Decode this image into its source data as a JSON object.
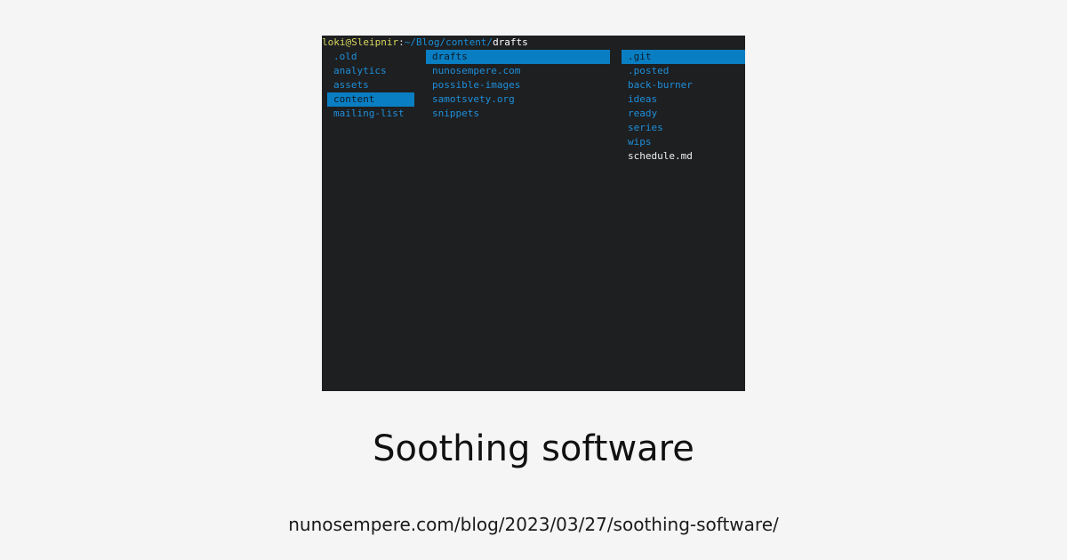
{
  "terminal": {
    "prompt": {
      "user": "loki@Sleipnir",
      "separator": ":",
      "path": "~/Blog/content/",
      "current": "drafts"
    },
    "parent_column": [
      {
        "name": ".old",
        "selected": false
      },
      {
        "name": "analytics",
        "selected": false
      },
      {
        "name": "assets",
        "selected": false
      },
      {
        "name": "content",
        "selected": true
      },
      {
        "name": "mailing-list",
        "selected": false
      }
    ],
    "current_column": [
      {
        "name": "drafts",
        "selected": true
      },
      {
        "name": "nunosempere.com",
        "selected": false
      },
      {
        "name": "possible-images",
        "selected": false
      },
      {
        "name": "samotsvety.org",
        "selected": false
      },
      {
        "name": "snippets",
        "selected": false
      }
    ],
    "preview_column": [
      {
        "name": ".git",
        "selected": true,
        "type": "dir"
      },
      {
        "name": ".posted",
        "selected": false,
        "type": "dir"
      },
      {
        "name": "back-burner",
        "selected": false,
        "type": "dir"
      },
      {
        "name": "ideas",
        "selected": false,
        "type": "dir"
      },
      {
        "name": "ready",
        "selected": false,
        "type": "dir"
      },
      {
        "name": "series",
        "selected": false,
        "type": "dir"
      },
      {
        "name": "wips",
        "selected": false,
        "type": "dir"
      },
      {
        "name": "schedule.md",
        "selected": false,
        "type": "file"
      }
    ]
  },
  "caption": {
    "title": "Soothing software",
    "url": "nunosempere.com/blog/2023/03/27/soothing-software/"
  },
  "colors": {
    "background": "#f5f5f5",
    "terminal_bg": "#1e1f21",
    "dir_blue": "#1e8fd9",
    "selection_bg": "#0a7ec2",
    "user_yellow": "#d7d75f"
  }
}
